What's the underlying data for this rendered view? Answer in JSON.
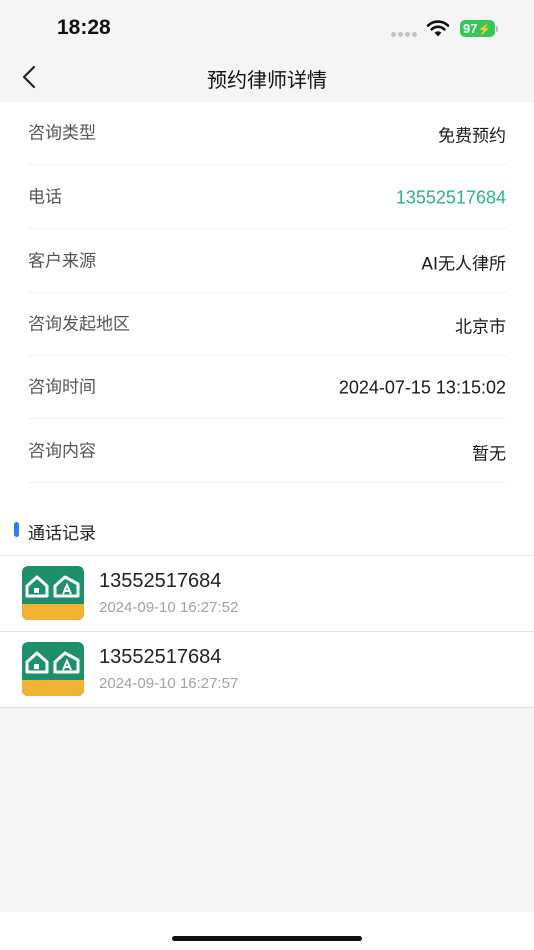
{
  "status_bar": {
    "time": "18:28",
    "battery": "97"
  },
  "nav": {
    "title": "预约律师详情",
    "back_icon": "chevron-left-icon"
  },
  "details": [
    {
      "label": "咨询类型",
      "value": "免费预约"
    },
    {
      "label": "电话",
      "value": "13552517684"
    },
    {
      "label": "客户来源",
      "value": "AI无人律所"
    },
    {
      "label": "咨询发起地区",
      "value": "北京市"
    },
    {
      "label": "咨询时间",
      "value": "2024-07-15 13:15:02"
    },
    {
      "label": "咨询内容",
      "value": "暂无"
    }
  ],
  "call_records": {
    "title": "通话记录",
    "items": [
      {
        "number": "13552517684",
        "time": "2024-09-10 16:27:52",
        "icon": "app-logo-icon"
      },
      {
        "number": "13552517684",
        "time": "2024-09-10 16:27:57",
        "icon": "app-logo-icon"
      }
    ]
  },
  "colors": {
    "accent_green": "#2bb38a",
    "accent_blue": "#2f7cf6",
    "battery_green": "#34c759"
  }
}
